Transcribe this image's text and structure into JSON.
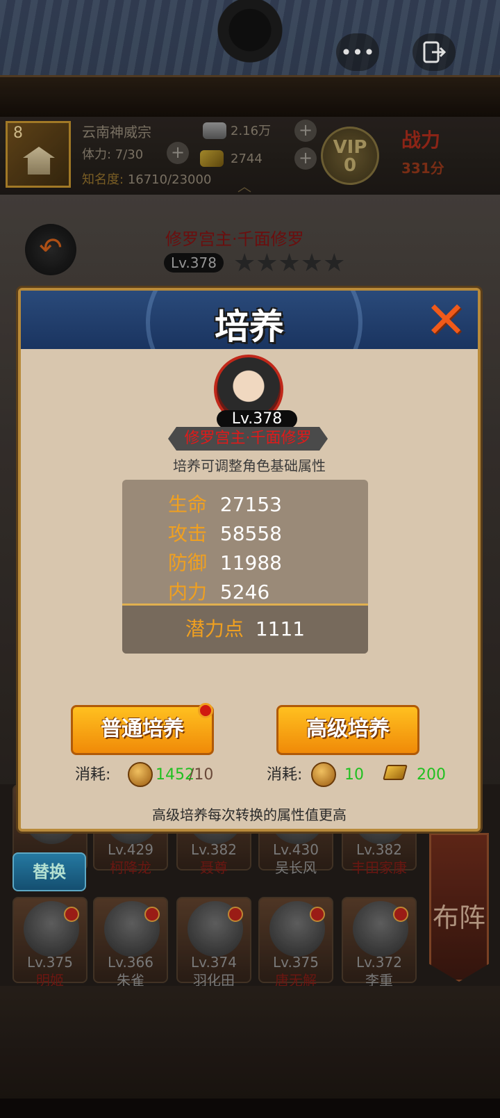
{
  "topbar": {
    "more_icon": "more-dots-icon",
    "exit_icon": "exit-icon"
  },
  "player": {
    "level": "8",
    "sect": "云南神威宗",
    "stamina": "体力: 7/30",
    "fame_label": "知名度:",
    "fame_value": "16710/23000",
    "silver": "2.16万",
    "gold": "2744",
    "vip_label": "VIP",
    "vip_level": "0",
    "power_label": "战力",
    "power_value": "331分"
  },
  "hero": {
    "name": "修罗宫主·千面修罗",
    "level": "Lv.378",
    "stars": "★★★★★"
  },
  "modal": {
    "title": "培养",
    "close_icon": "close-x-icon",
    "portrait_level": "Lv.378",
    "hero_name": "修罗宫主·千面修罗",
    "subtitle": "培养可调整角色基础属性",
    "stats": [
      {
        "label": "生命",
        "value": "27153"
      },
      {
        "label": "攻击",
        "value": "58558"
      },
      {
        "label": "防御",
        "value": "11988"
      },
      {
        "label": "内力",
        "value": "5246"
      }
    ],
    "potential_label": "潜力点",
    "potential_value": "1111",
    "normal_button": "普通培养",
    "advanced_button": "高级培养",
    "cost_label_1": "消耗:",
    "cost_normal_have": "1452",
    "cost_normal_need": "/10",
    "cost_label_2": "消耗:",
    "cost_adv_pill": "10",
    "cost_adv_gold": "200",
    "footer": "高级培养每次转换的属性值更高"
  },
  "roster": {
    "swap_button": "替换",
    "formation_button": "布阵",
    "row1": [
      {
        "level": "Lv.429",
        "name": "柯降龙"
      },
      {
        "level": "Lv.382",
        "name": "聂尊"
      },
      {
        "level": "Lv.430",
        "name": "吴长风"
      },
      {
        "level": "Lv.382",
        "name": "丰田家康"
      }
    ],
    "row2": [
      {
        "level": "Lv.375",
        "name": "明姬"
      },
      {
        "level": "Lv.366",
        "name": "朱雀"
      },
      {
        "level": "Lv.374",
        "name": "羽化田"
      },
      {
        "level": "Lv.375",
        "name": "唐无解"
      },
      {
        "level": "Lv.372",
        "name": "李重"
      }
    ]
  },
  "colors": {
    "accent_orange": "#f0a020",
    "modal_bg": "#d8c6ae",
    "header_blue": "#1a3460",
    "cost_green": "#20c020",
    "name_red": "#e01a1a"
  }
}
